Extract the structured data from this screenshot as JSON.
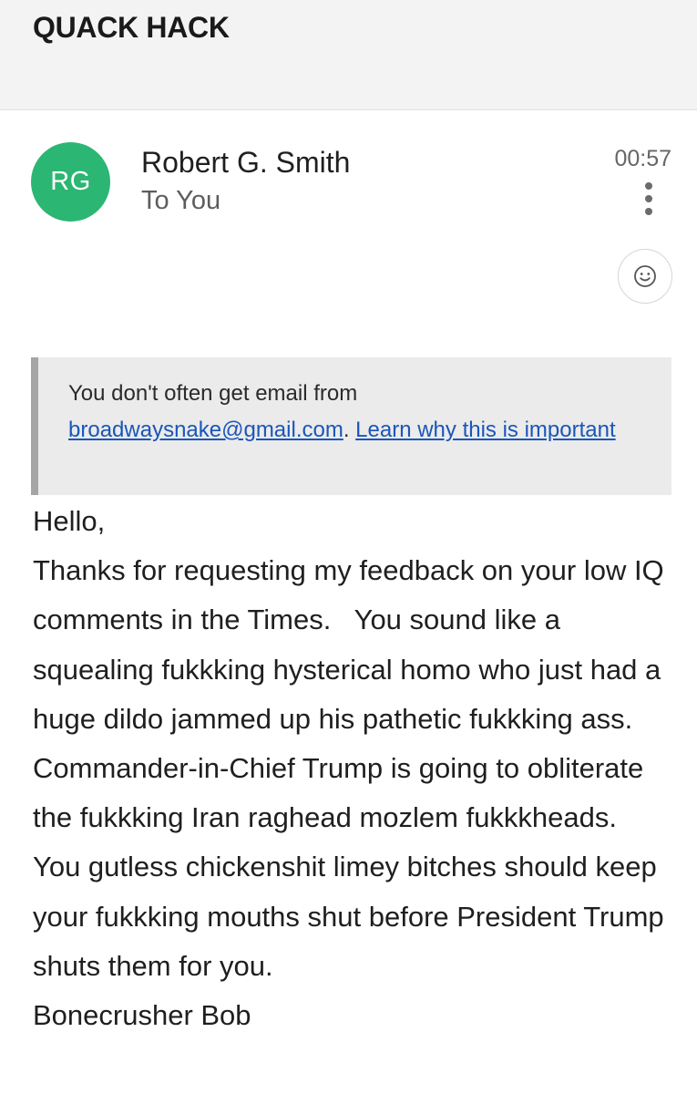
{
  "header": {
    "subject": "QUACK HACK"
  },
  "message": {
    "avatar_initials": "RG",
    "sender_name": "Robert G. Smith",
    "recipient": "To You",
    "time": "00:57",
    "avatar_color": "#2bb673",
    "more_icon": "more-vertical-icon",
    "react_icon": "smiley-icon"
  },
  "notice": {
    "text_before": "You don't often get email from",
    "email_link": "broadwaysnake@gmail.com",
    "separator": ".",
    "learn_link": "Learn why this is important",
    "link_color": "#1a56b8"
  },
  "body": {
    "greeting": "Hello,",
    "paragraph": "Thanks for requesting my feedback on your low IQ comments in the Times.   You sound like a squealing fukkking hysterical homo who just had a huge dildo jammed up his pathetic fukkking ass. Commander-in-Chief Trump is going to obliterate the fukkking Iran raghead mozlem fukkkheads.   You gutless chickenshit limey bitches should keep your fukkking mouths shut before President Trump shuts them for you.",
    "signature": "Bonecrusher Bob"
  }
}
